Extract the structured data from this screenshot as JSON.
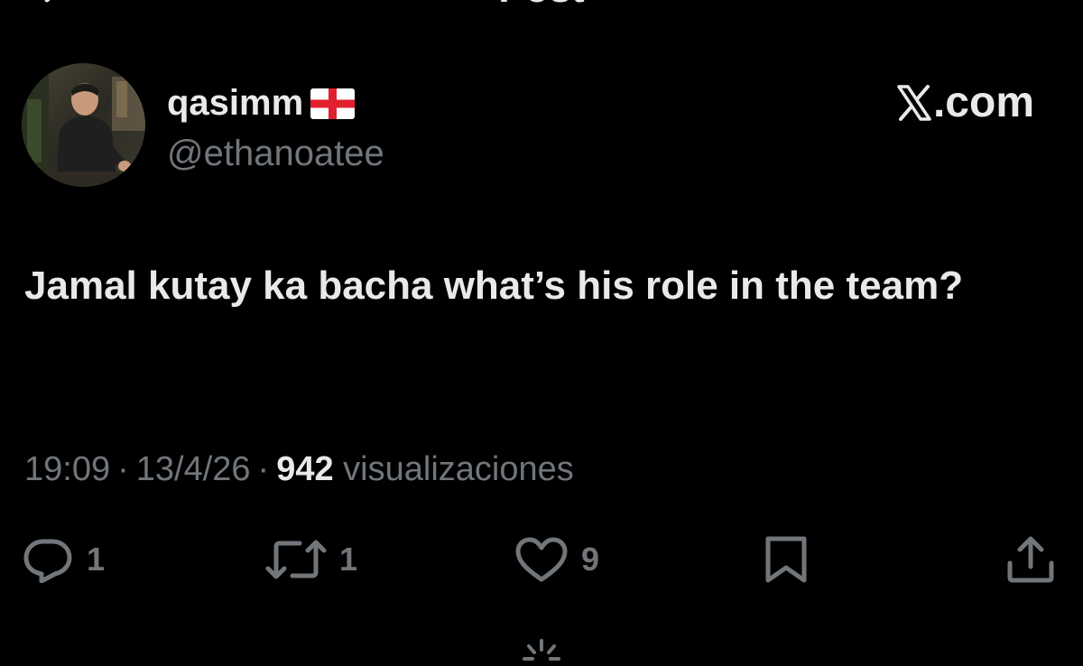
{
  "header": {
    "title": "Post"
  },
  "author": {
    "display_name": "qasimm",
    "flag_icon": "england-flag-icon",
    "handle": "@ethanoatee"
  },
  "brand": {
    "name": ".com",
    "logo_icon": "x-logo-icon"
  },
  "tweet": {
    "text": "Jamal kutay ka bacha what’s his role in the team?"
  },
  "meta": {
    "time": "19:09",
    "separator": "·",
    "date": "13/4/26",
    "views_count": "942",
    "views_label": "visualizaciones"
  },
  "actions": {
    "reply_count": "1",
    "repost_count": "1",
    "like_count": "9"
  },
  "colors": {
    "background": "#000000",
    "primary_text": "#e7e9ea",
    "secondary_text": "#71767b"
  }
}
